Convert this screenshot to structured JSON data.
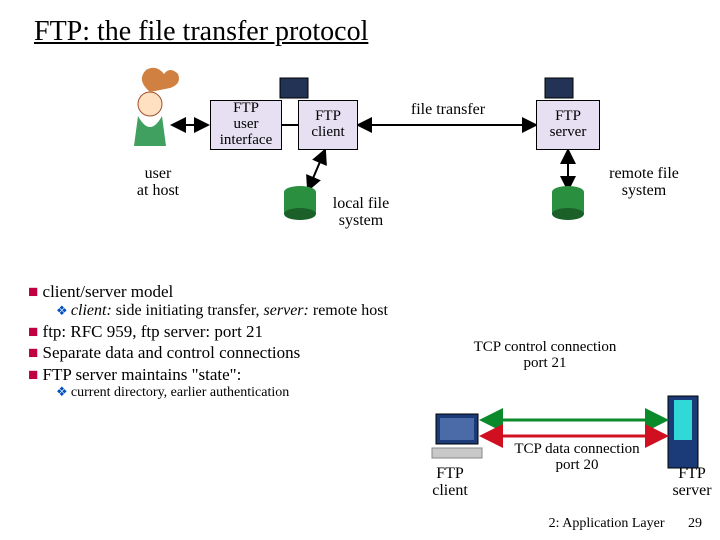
{
  "title": "FTP: the file transfer protocol",
  "diagram_top": {
    "user_at_host": "user\nat host",
    "ftp_ui": "FTP\nuser\ninterface",
    "ftp_client": "FTP\nclient",
    "file_transfer": "file transfer",
    "ftp_server": "FTP\nserver",
    "local_fs": "local file\nsystem",
    "remote_fs": "remote file\nsystem"
  },
  "bullets": {
    "b1": "client/server model",
    "b1a_client": "client:",
    "b1a_client_desc": " side initiating transfer, ",
    "b1a_server": "server:",
    "b1a_server_desc": " remote host",
    "b2": "ftp: RFC 959, ftp server: port 21",
    "b3": "Separate data and control connections",
    "b4": "FTP server maintains \"state\":",
    "b4a": "current directory, earlier authentication"
  },
  "diagram_bottom": {
    "ctrl": "TCP control connection\nport 21",
    "data": "TCP data connection\nport 20",
    "ftp_client": "FTP\nclient",
    "ftp_server": "FTP\nserver"
  },
  "footer": {
    "layer": "2: Application Layer",
    "page": "29"
  }
}
